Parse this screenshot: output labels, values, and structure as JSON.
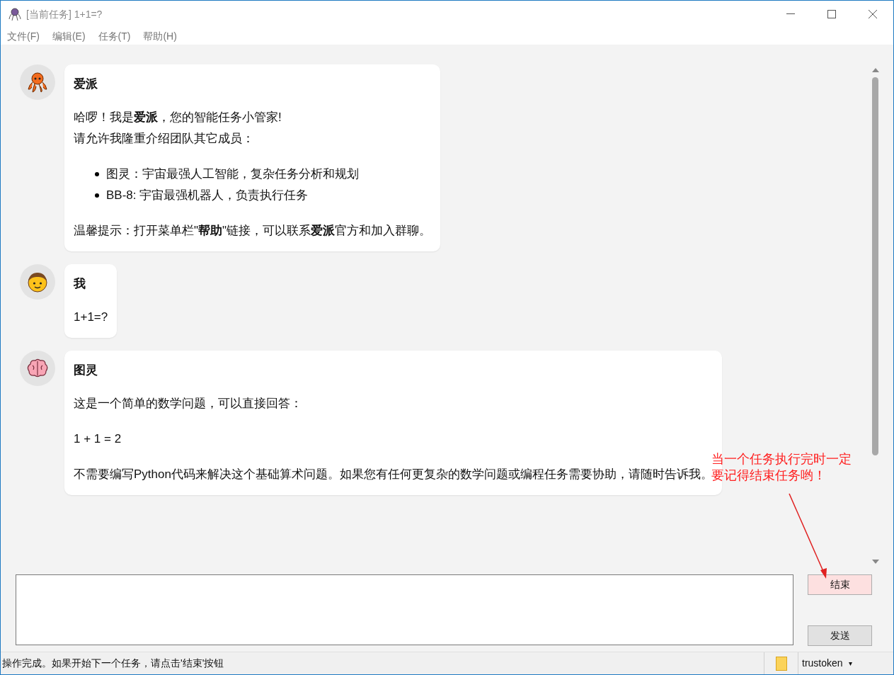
{
  "window": {
    "title": "[当前任务] 1+1=?"
  },
  "menu": [
    "文件(F)",
    "编辑(E)",
    "任务(T)",
    "帮助(H)"
  ],
  "messages": [
    {
      "kind": "octopus",
      "sender": "爱派",
      "blocks": [
        {
          "kind": "paragraph",
          "lines": [
            "哈啰！我是**爱派**，您的智能任务小管家!",
            "请允许我隆重介绍团队其它成员："
          ]
        },
        {
          "kind": "list",
          "items": [
            "图灵：宇宙最强人工智能，复杂任务分析和规划",
            "BB-8: 宇宙最强机器人，负责执行任务"
          ]
        },
        {
          "kind": "paragraph",
          "lines": [
            "温馨提示：打开菜单栏\"**帮助**\"链接，可以联系**爱派**官方和加入群聊。"
          ]
        }
      ]
    },
    {
      "kind": "boy",
      "sender": "我",
      "blocks": [
        {
          "kind": "paragraph",
          "lines": [
            "1+1=?"
          ]
        }
      ]
    },
    {
      "kind": "brain",
      "sender": "图灵",
      "blocks": [
        {
          "kind": "paragraph",
          "lines": [
            "这是一个简单的数学问题，可以直接回答："
          ]
        },
        {
          "kind": "paragraph",
          "lines": [
            "1 + 1 = 2"
          ]
        },
        {
          "kind": "paragraph",
          "lines": [
            "不需要编写Python代码来解决这个基础算术问题。如果您有任何更复杂的数学问题或编程任务需要协助，请随时告诉我。"
          ]
        }
      ]
    }
  ],
  "annotation": "当一个任务执行完时一定要记得结束任务哟！",
  "buttons": [
    {
      "label": "结束",
      "kind": "end"
    },
    {
      "label": "发送",
      "kind": "send"
    }
  ],
  "status_bar": {
    "message": "操作完成。如果开始下一个任务，请点击'结束'按钮",
    "account": "trustoken",
    "account_caret": "▾"
  }
}
